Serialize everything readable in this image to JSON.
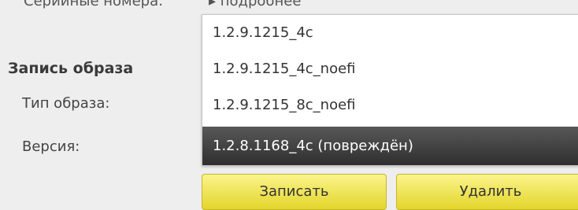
{
  "top_row": {
    "label": "Серийные номера:",
    "value": "▸ подробнее"
  },
  "section": {
    "title": "Запись образа"
  },
  "fields": {
    "image_type_label": "Тип образа:",
    "version_label": "Версия:"
  },
  "dropdown": {
    "options": [
      "1.2.9.1215_4c",
      "1.2.9.1215_4c_noefi",
      "1.2.9.1215_8c_noefi",
      "1.2.8.1168_4c (повреждён)"
    ],
    "highlighted_index": 3
  },
  "buttons": {
    "write_label": "Записать",
    "delete_label": "Удалить"
  },
  "colors": {
    "background": "#eeeeee",
    "button_yellow": "#efe45a",
    "highlight_dark": "#3d3d3d"
  }
}
